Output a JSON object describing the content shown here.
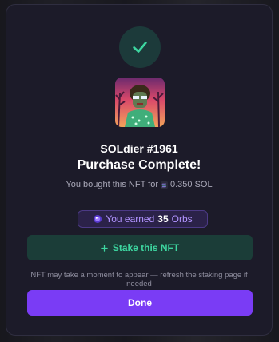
{
  "colors": {
    "modal_bg": "#1c1b29",
    "success_green": "#3dd6a0",
    "accent_purple": "#7a3cf5",
    "orbs_purple": "#b294ff"
  },
  "status_icon": "checkmark-icon",
  "nft": {
    "name": "SOLdier #1961",
    "image_icon": "nft-avatar"
  },
  "title": "Purchase Complete!",
  "bought": {
    "prefix": "You bought this NFT for",
    "currency_icon": "sol-icon",
    "amount": "0.350 SOL"
  },
  "orbs": {
    "icon": "orb-icon",
    "prefix": "You earned",
    "count": "35",
    "suffix": "Orbs"
  },
  "stake_button": {
    "icon": "plus-icon",
    "label": "Stake this NFT"
  },
  "note": "NFT may take a moment to appear — refresh the staking page if needed",
  "done_button": {
    "label": "Done"
  }
}
